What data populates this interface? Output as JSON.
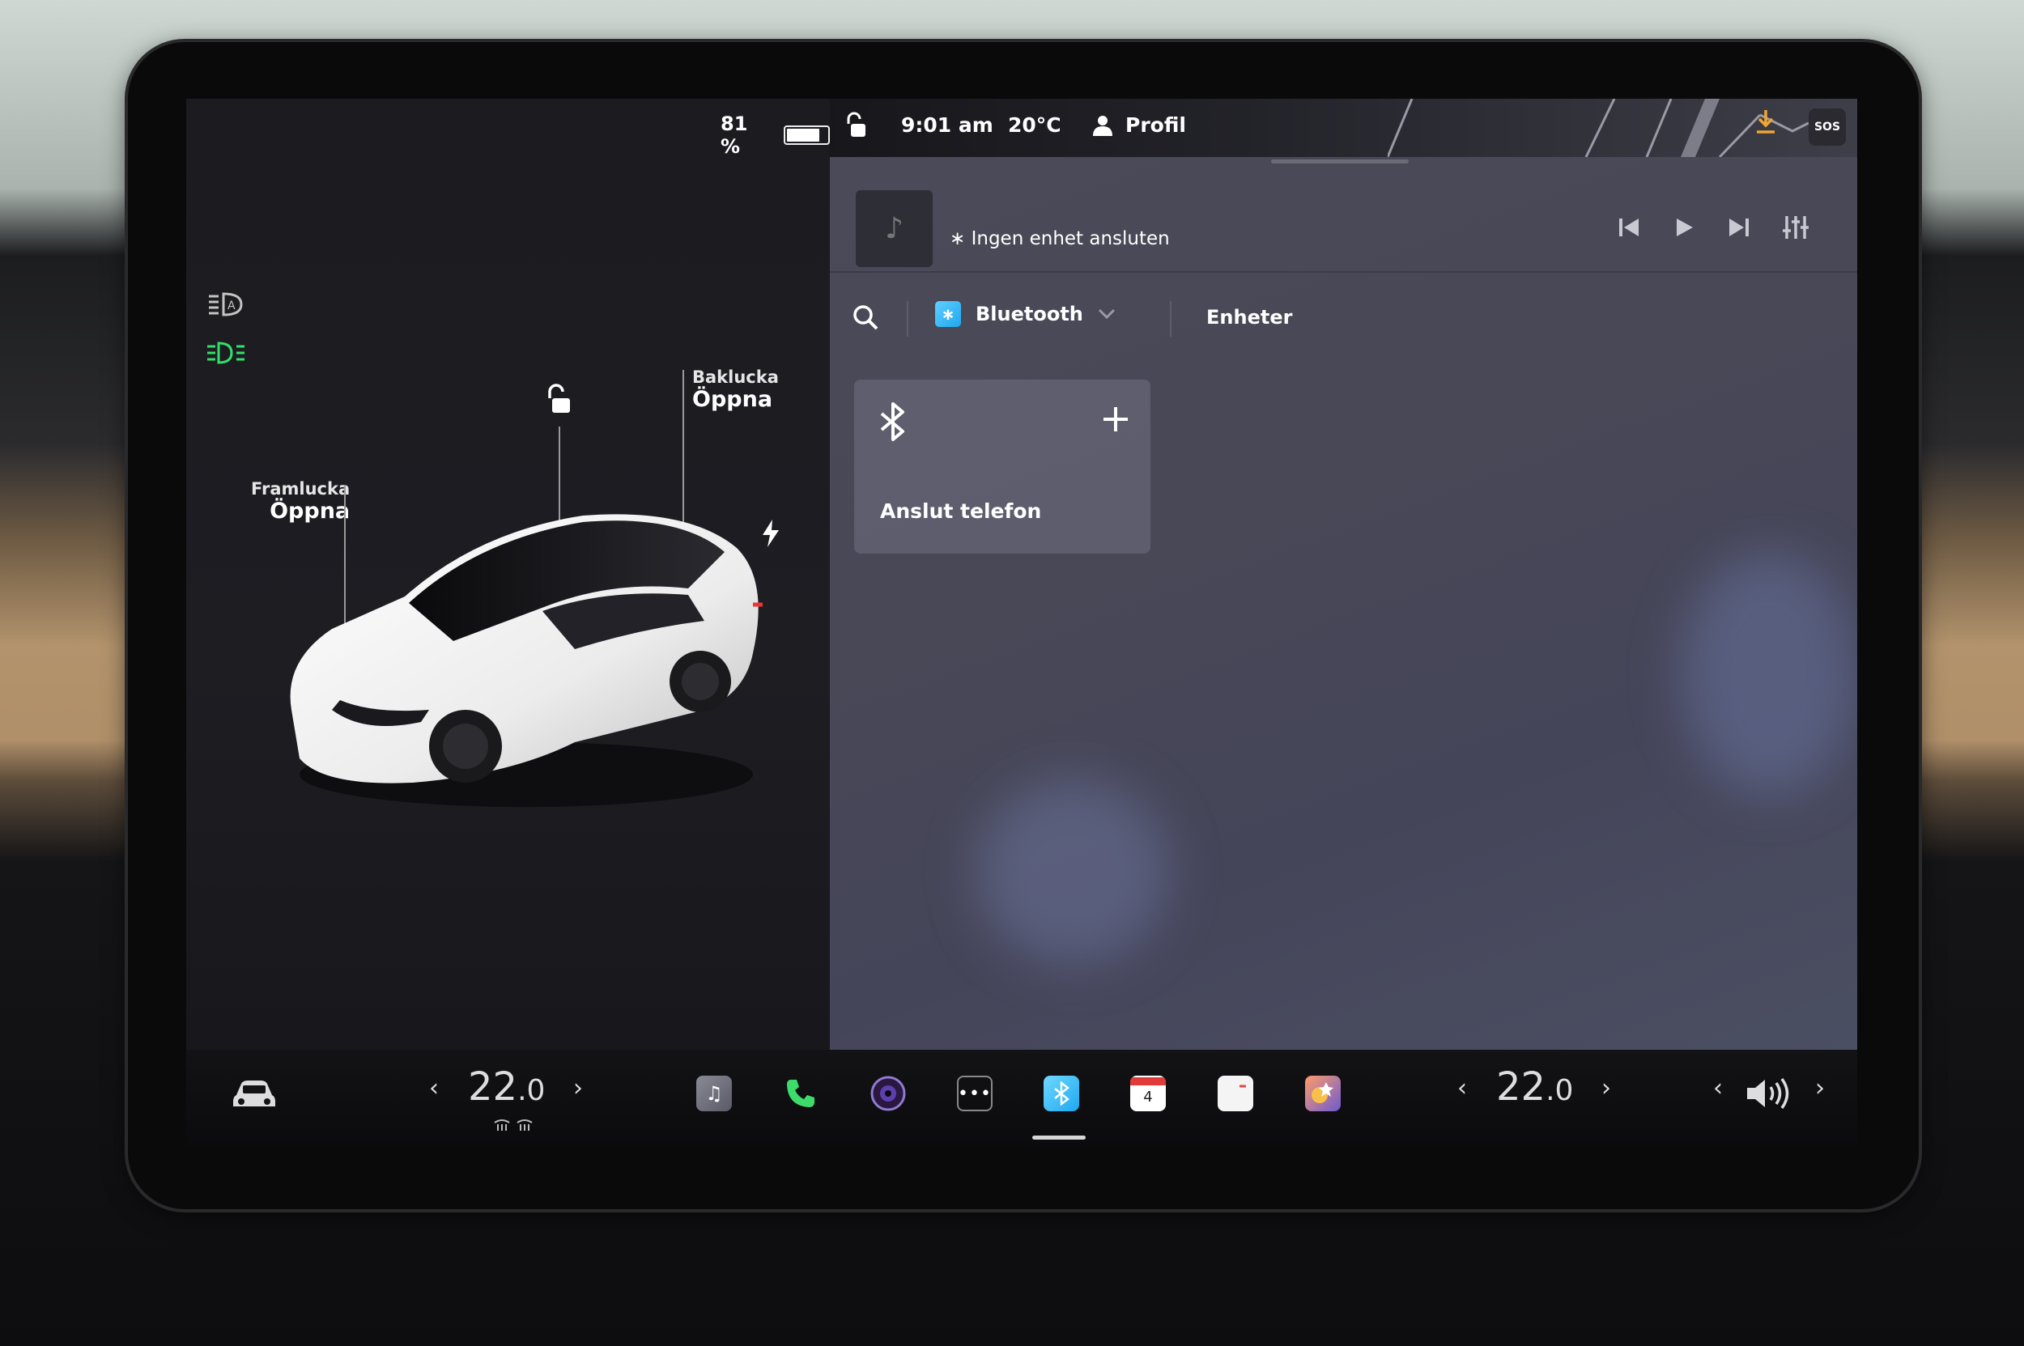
{
  "left": {
    "battery_percent": "81 %",
    "battery_fill_percent": 81,
    "front_trunk": {
      "title": "Framlucka",
      "action": "Öppna"
    },
    "rear_trunk": {
      "title": "Baklucka",
      "action": "Öppna"
    }
  },
  "status": {
    "time": "9:01 am",
    "temperature": "20°C",
    "profile_label": "Profil",
    "sos_label": "SOS"
  },
  "media": {
    "now_playing": "Ingen enhet ansluten"
  },
  "source": {
    "selected": "Bluetooth",
    "devices_tab": "Enheter"
  },
  "connect_card": {
    "label": "Anslut telefon"
  },
  "dock": {
    "left_temp_main": "22",
    "left_temp_dec": ".0",
    "right_temp_main": "22",
    "right_temp_dec": ".0",
    "calendar_day": "4"
  },
  "icons": [
    "auto-headlights-icon",
    "fog-lights-icon",
    "lock-icon",
    "charge-icon",
    "music-icon",
    "phone-icon",
    "camera-icon",
    "more-icon",
    "bluetooth-icon",
    "calendar-icon",
    "notes-icon",
    "toybox-icon",
    "car-icon",
    "volume-icon"
  ],
  "colors": {
    "accent_green": "#33e06b",
    "bluetooth_blue": "#1fa7f0",
    "download_orange": "#f2a530"
  }
}
